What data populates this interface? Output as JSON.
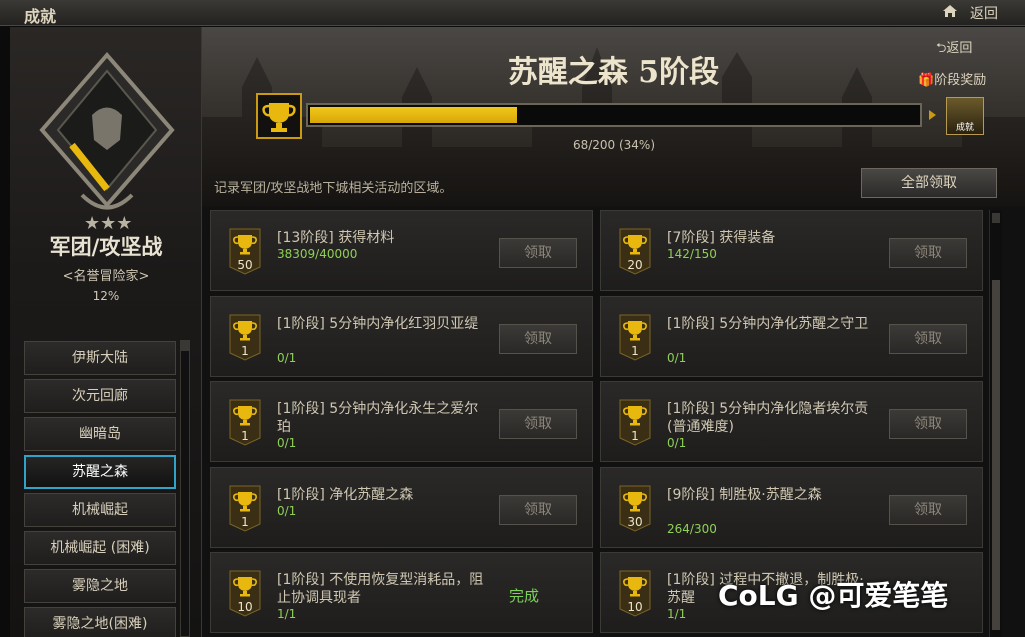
{
  "window": {
    "title": "成就",
    "back_label": "返回"
  },
  "sidebar": {
    "category_title": "军团/攻坚战",
    "category_subtitle": "<名誉冒险家>",
    "category_percent": "12%",
    "items": [
      {
        "label": "伊斯大陆",
        "active": false
      },
      {
        "label": "次元回廊",
        "active": false
      },
      {
        "label": "幽暗岛",
        "active": false
      },
      {
        "label": "苏醒之森",
        "active": true
      },
      {
        "label": "机械崛起",
        "active": false
      },
      {
        "label": "机械崛起 (困难)",
        "active": false
      },
      {
        "label": "雾隐之地",
        "active": false
      },
      {
        "label": "雾隐之地(困难)",
        "active": false
      }
    ]
  },
  "header": {
    "stage_title": "苏醒之森 5阶段",
    "back_label": "返回",
    "stage_reward_label": "阶段奖励",
    "progress_text": "68/200 (34%)",
    "progress_fraction": 0.34,
    "reward_box_label": "成就",
    "description": "记录军团/攻坚战地下城相关活动的区域。",
    "claim_all_label": "全部领取"
  },
  "achievements": [
    {
      "points": "50",
      "title": "[13阶段] 获得材料",
      "count": "38309/40000",
      "action": "领取"
    },
    {
      "points": "20",
      "title": "[7阶段] 获得装备",
      "count": "142/150",
      "action": "领取"
    },
    {
      "points": "1",
      "title": "[1阶段] 5分钟内净化红羽贝亚缇",
      "count": "0/1",
      "action": "领取"
    },
    {
      "points": "1",
      "title": "[1阶段] 5分钟内净化苏醒之守卫",
      "count": "0/1",
      "action": "领取"
    },
    {
      "points": "1",
      "title": "[1阶段] 5分钟内净化永生之爱尔珀",
      "count": "0/1",
      "action": "领取"
    },
    {
      "points": "1",
      "title": "[1阶段] 5分钟内净化隐者埃尔贡 (普通难度)",
      "count": "0/1",
      "action": "领取"
    },
    {
      "points": "1",
      "title": "[1阶段] 净化苏醒之森",
      "count": "0/1",
      "action": "领取"
    },
    {
      "points": "30",
      "title": "[9阶段] 制胜极·苏醒之森",
      "count": "264/300",
      "action": "领取"
    },
    {
      "points": "10",
      "title": "[1阶段] 不使用恢复型消耗品，阻止协调具现者",
      "count": "1/1",
      "action": "完成"
    },
    {
      "points": "10",
      "title": "[1阶段] 过程中不撤退，制胜极·苏醒",
      "count": "1/1",
      "action": ""
    }
  ],
  "watermark": "CoLG @可爱笔笔",
  "colors": {
    "accent_gold": "#e8b80f",
    "done_green": "#7bd05a",
    "active_border": "#2fa3c8"
  }
}
